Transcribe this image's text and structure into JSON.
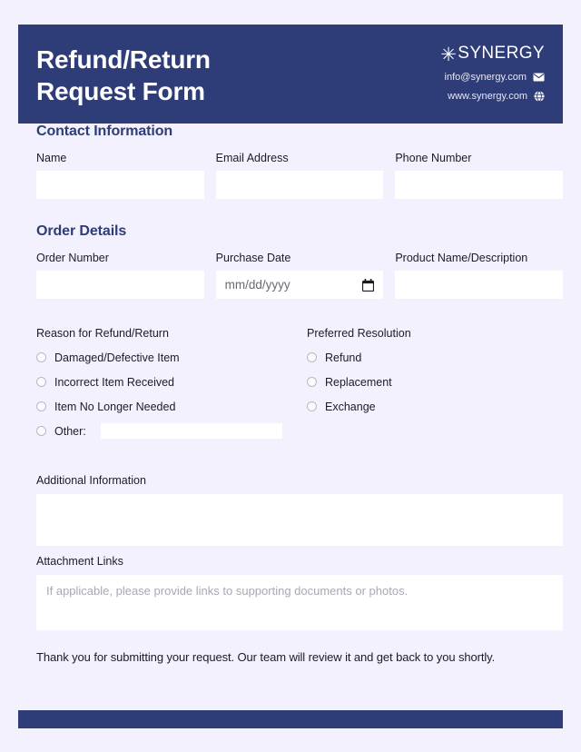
{
  "header": {
    "title": "Refund/Return\nRequest Form",
    "brand_mark": "✳",
    "brand_name": "SYNERGY",
    "email": "info@synergy.com",
    "website": "www.synergy.com",
    "email_icon": "envelope-icon",
    "website_icon": "globe-icon",
    "background_color": "#2e3c78",
    "text_color": "#ffffff"
  },
  "sections": {
    "contact": {
      "title": "Contact Information",
      "fields": [
        {
          "label": "Name",
          "value": "",
          "placeholder": ""
        },
        {
          "label": "Email Address",
          "value": "",
          "placeholder": ""
        },
        {
          "label": "Phone Number",
          "value": "",
          "placeholder": ""
        }
      ]
    },
    "order": {
      "title": "Order Details",
      "fields": [
        {
          "label": "Order Number",
          "value": "",
          "placeholder": ""
        },
        {
          "label": "Purchase Date",
          "value": "",
          "placeholder": "mm/dd/yyyy",
          "icon": "calendar-icon"
        },
        {
          "label": "Product Name/Description",
          "value": "",
          "placeholder": ""
        }
      ]
    }
  },
  "reason_group": {
    "label": "Reason for Refund/Return",
    "options": [
      "Damaged/Defective Item",
      "Incorrect Item Received",
      "Item No Longer Needed",
      "Other:"
    ],
    "other_value": "",
    "other_placeholder": ""
  },
  "resolution_group": {
    "label": "Preferred Resolution",
    "options": [
      "Refund",
      "Replacement",
      "Exchange"
    ]
  },
  "additional_information": {
    "label": "Additional Information",
    "value": "",
    "placeholder": ""
  },
  "attachment_links": {
    "label": "Attachment Links",
    "value": "",
    "placeholder": "If applicable, please provide links to supporting documents or photos."
  },
  "footer": {
    "thanks": "Thank you for submitting your request. Our team will review it and get back to you shortly.",
    "bar_color": "#2e3c78"
  },
  "theme": {
    "page_background": "#f2f1fd",
    "accent": "#2e3c78",
    "input_background": "#ffffff"
  }
}
